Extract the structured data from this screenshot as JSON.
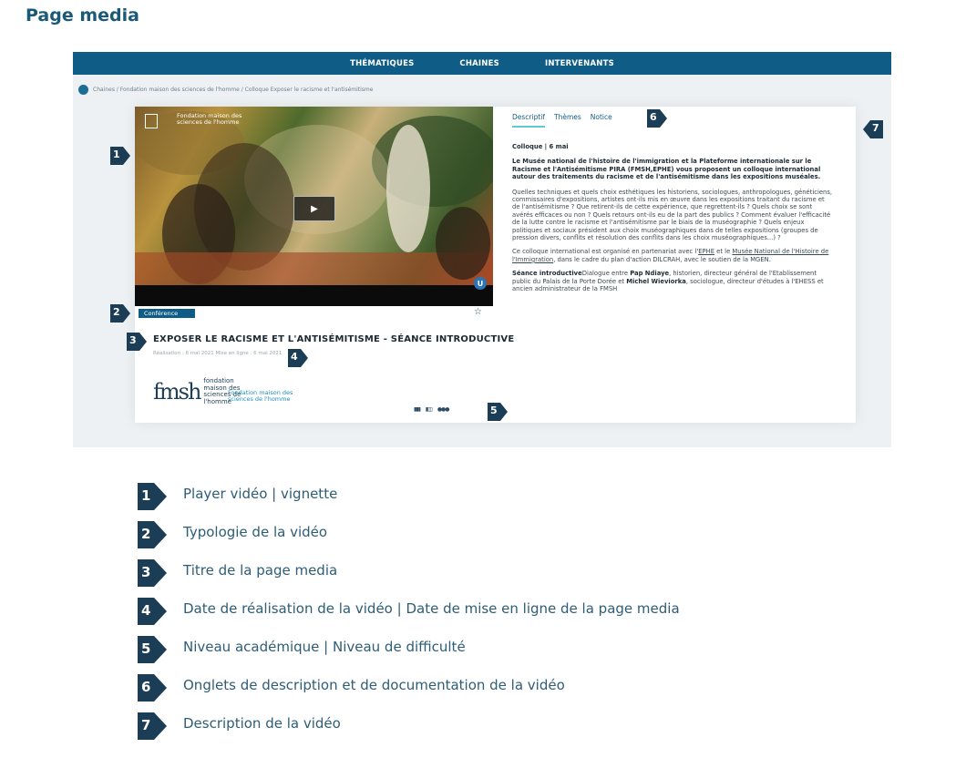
{
  "page": {
    "title": "Page media"
  },
  "nav": {
    "items": [
      "THÉMATIQUES",
      "CHAINES",
      "INTERVENANTS"
    ]
  },
  "breadcrumb": "Chaines / Fondation maison des sciences de l'homme / Colloque Exposer le racisme et l'antisémitisme",
  "video": {
    "org_name": "Fondation maison des sciences de l'homme",
    "badge": "U"
  },
  "media": {
    "type_tag": "Conférence",
    "title": "EXPOSER LE RACISME ET L'ANTISÉMITISME - SÉANCE INTRODUCTIVE",
    "dates": "Réalisation : 6 mai 2021 Mise en ligne : 6 mai 2021",
    "org_logo_mark": "fmsh",
    "org_logo_text": "fondation maison des sciences de l'homme",
    "org_logo_sub": "Fondation maison des sciences de l'homme",
    "levels": [
      "▮▮▮",
      "▮▯▯",
      "●●●"
    ]
  },
  "tabs": [
    "Descriptif",
    "Thèmes",
    "Notice"
  ],
  "description": {
    "date": "Colloque | 6 mai",
    "lead": "Le Musée national de l'histoire de l'immigration et la Plateforme internationale sur le Racisme et l'Antisémitisme PIRA (FMSH,EPHE) vous proposent un colloque international autour des traitements du racisme et de l'antisémitisme dans les expositions muséales.",
    "p1": "Quelles techniques et quels choix esthétiques les historiens, sociologues, anthropologues, généticiens, commissaires d'expositions, artistes ont-ils mis en œuvre dans les expositions traitant du racisme et de l'antisémitisme ? Que retirent-ils de cette expérience, que regrettent-ils ? Quels choix se sont avérés efficaces ou non ? Quels retours ont-ils eu de la part des publics ? Comment évaluer l'efficacité de la lutte contre le racisme et l'antisémitisme par le biais de la muséographie ? Quels enjeux politiques et sociaux président aux choix muséographiques dans de telles expositions (groupes de pression divers, conflits et résolution des conflits dans les choix muséographiques...) ?",
    "p2_a": "Ce colloque international est organisé en partenariat avec l'",
    "p2_link1": "EPHE",
    "p2_b": " et le ",
    "p2_link2": "Musée National de l'Histoire de l'Immigration",
    "p2_c": ", dans le cadre du plan d'action DILCRAH, avec le soutien de la MGEN.",
    "p3_label": "Séance introductive",
    "p3_a": "Dialogue entre ",
    "p3_name1": "Pap Ndiaye",
    "p3_b": ", historien, directeur général de l'Etablissement public du Palais de la Porte Dorée et ",
    "p3_name2": "Michel Wieviorka",
    "p3_c": ", sociologue, directeur d'études à l'EHESS et ancien administrateur de la FMSH"
  },
  "badges": [
    "1",
    "2",
    "3",
    "4",
    "5",
    "6",
    "7"
  ],
  "legend": [
    {
      "num": "1",
      "label": "Player vidéo | vignette"
    },
    {
      "num": "2",
      "label": "Typologie de la vidéo"
    },
    {
      "num": "3",
      "label": "Titre de la page media"
    },
    {
      "num": "4",
      "label": "Date de réalisation de la vidéo | Date de mise en ligne de la page media"
    },
    {
      "num": "5",
      "label": "Niveau académique | Niveau de difficulté"
    },
    {
      "num": "6",
      "label": "Onglets de description et de documentation de la vidéo"
    },
    {
      "num": "7",
      "label": "Description de la vidéo"
    }
  ],
  "colors": {
    "nav": "#0f5d86",
    "badge": "#1b3d56",
    "accent": "#5ccbd4"
  }
}
